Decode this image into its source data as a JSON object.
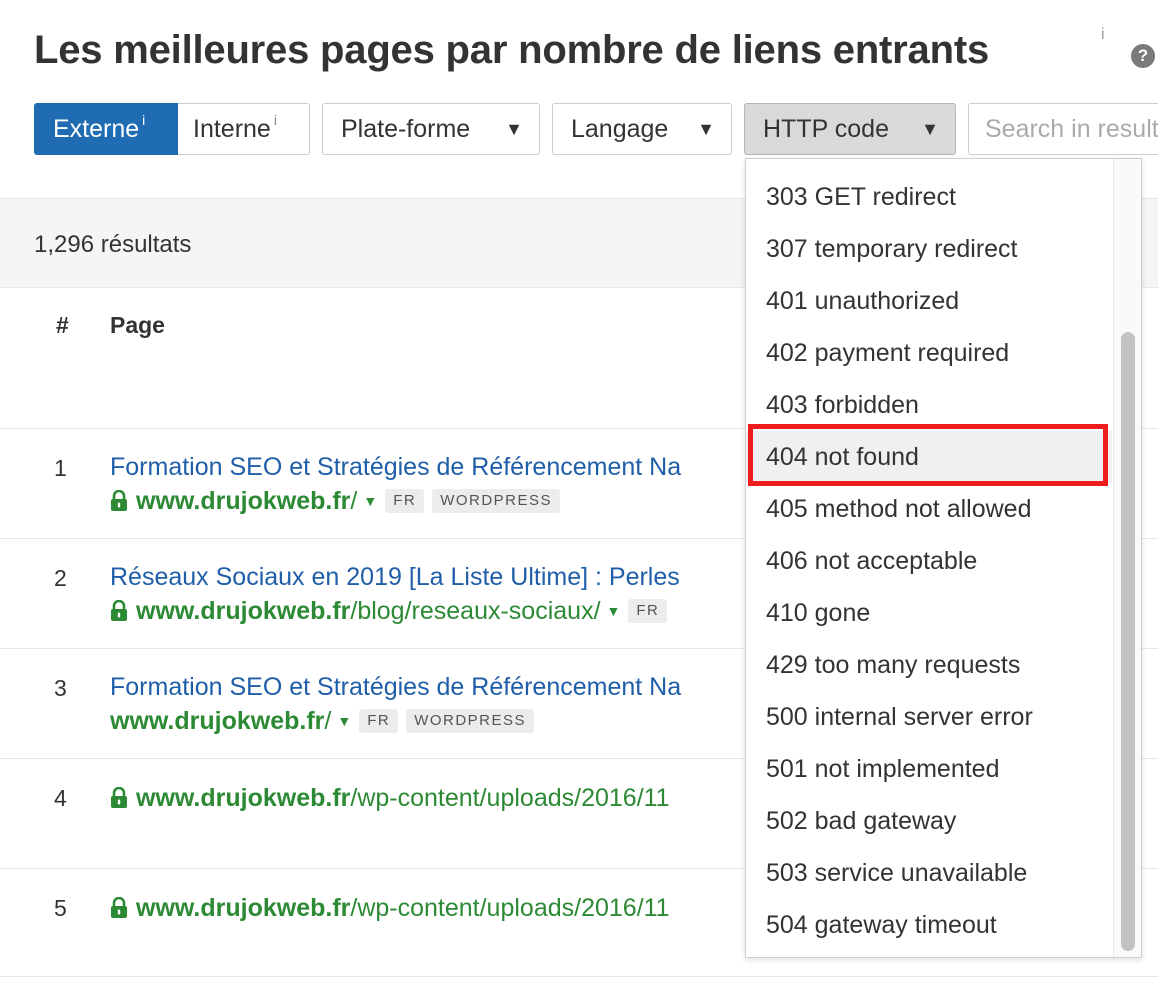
{
  "page": {
    "title": "Les meilleures pages par nombre de liens entrants",
    "title_info": "i",
    "help_icon_glyph": "?"
  },
  "filters": {
    "external_label": "Externe",
    "internal_label": "Interne",
    "info_glyph": "i",
    "platform_label": "Plate-forme",
    "language_label": "Langage",
    "http_code_label": "HTTP code",
    "caret_glyph": "▼",
    "search_placeholder": "Search in results",
    "active_color": "#1f6cb3"
  },
  "results": {
    "count_text": "1,296 résultats"
  },
  "table": {
    "headers": {
      "num": "#",
      "page": "Page"
    },
    "rows": [
      {
        "num": "1",
        "title": "Formation SEO et Stratégies de Référencement Na",
        "secure": true,
        "domain": "www.drujokweb.fr",
        "path": "/",
        "tags": [
          "FR",
          "WORDPRESS"
        ]
      },
      {
        "num": "2",
        "title": "Réseaux Sociaux en 2019 [La Liste Ultime] : Perles",
        "secure": true,
        "domain": "www.drujokweb.fr",
        "path": "/blog/reseaux-sociaux/",
        "tags": [
          "FR"
        ]
      },
      {
        "num": "3",
        "title": "Formation SEO et Stratégies de Référencement Na",
        "secure": false,
        "domain": "www.drujokweb.fr",
        "path": "/",
        "tags": [
          "FR",
          "WORDPRESS"
        ]
      },
      {
        "num": "4",
        "title": "",
        "secure": true,
        "domain": "www.drujokweb.fr",
        "path": "/wp-content/uploads/2016/11",
        "tags": []
      },
      {
        "num": "5",
        "title": "",
        "secure": true,
        "domain": "www.drujokweb.fr",
        "path": "/wp-content/uploads/2016/11",
        "tags": []
      }
    ],
    "link_color": "#1f5ea8",
    "url_color": "#2d8a34"
  },
  "http_dropdown": {
    "options": [
      "303 GET redirect",
      "307 temporary redirect",
      "401 unauthorized",
      "402 payment required",
      "403 forbidden",
      "404 not found",
      "405 method not allowed",
      "406 not acceptable",
      "410 gone",
      "429 too many requests",
      "500 internal server error",
      "501 not implemented",
      "502 bad gateway",
      "503 service unavailable",
      "504 gateway timeout"
    ],
    "highlighted_option": "404 not found",
    "highlight_color": "#ee1c1c"
  }
}
